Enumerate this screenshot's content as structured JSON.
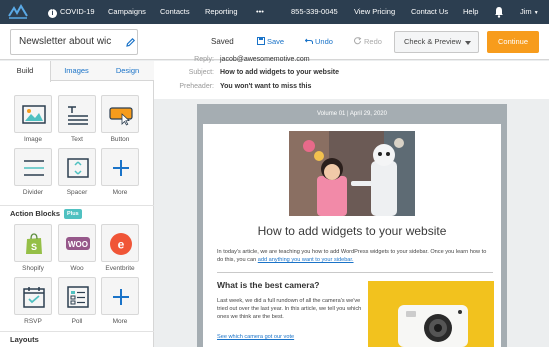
{
  "nav": {
    "covid": "COVID-19",
    "campaigns": "Campaigns",
    "contacts": "Contacts",
    "reporting": "Reporting",
    "more": "•••",
    "phone": "855-339-0045",
    "view_pricing": "View Pricing",
    "contact_us": "Contact Us",
    "help": "Help",
    "user": "Jim"
  },
  "toolbar": {
    "title": "Newsletter about wic",
    "saved": "Saved",
    "save": "Save",
    "undo": "Undo",
    "redo": "Redo",
    "check_preview": "Check & Preview",
    "continue": "Continue"
  },
  "sidebar": {
    "tabs": [
      "Build",
      "Images",
      "Design"
    ],
    "blocks": [
      {
        "label": "Image",
        "icon": "image-icon"
      },
      {
        "label": "Text",
        "icon": "text-icon"
      },
      {
        "label": "Button",
        "icon": "button-icon"
      },
      {
        "label": "Divider",
        "icon": "divider-icon"
      },
      {
        "label": "Spacer",
        "icon": "spacer-icon"
      },
      {
        "label": "More",
        "icon": "plus-icon"
      }
    ],
    "action_blocks_title": "Action Blocks",
    "plus_badge": "Plus",
    "action_blocks": [
      {
        "label": "Shopify",
        "icon": "shopify-icon"
      },
      {
        "label": "Woo",
        "icon": "woo-icon"
      },
      {
        "label": "Eventbrite",
        "icon": "eventbrite-icon"
      },
      {
        "label": "RSVP",
        "icon": "rsvp-icon"
      },
      {
        "label": "Poll",
        "icon": "poll-icon"
      },
      {
        "label": "More",
        "icon": "plus-icon"
      }
    ],
    "layouts_title": "Layouts"
  },
  "meta": {
    "reply_label": "Reply:",
    "reply_value": "jacob@awesomemotive.com",
    "subject_label": "Subject:",
    "subject_value": "How to add widgets to your website",
    "preheader_label": "Preheader:",
    "preheader_value": "You won't want to miss this"
  },
  "email": {
    "volume": "Volume 01 | April 29, 2020",
    "headline": "How to add widgets to your website",
    "intro": "In today's article, we are teaching you how to add WordPress widgets to your sidebar. Once you learn how to do this, you can ",
    "intro_link": "add anything you want to your sidebar.",
    "section_title": "What is the best camera?",
    "section_body": "Last week, we did a full rundown of all the camera's we've tried out over the last year. In this article, we tell you which ones we think are the best.",
    "section_link": "See which camera got our vote"
  },
  "colors": {
    "nav_bg": "#2c3e50",
    "accent": "#f79c1c",
    "link": "#1a73c8",
    "plus_badge": "#4fc1c1",
    "frame": "#a5adb2"
  }
}
